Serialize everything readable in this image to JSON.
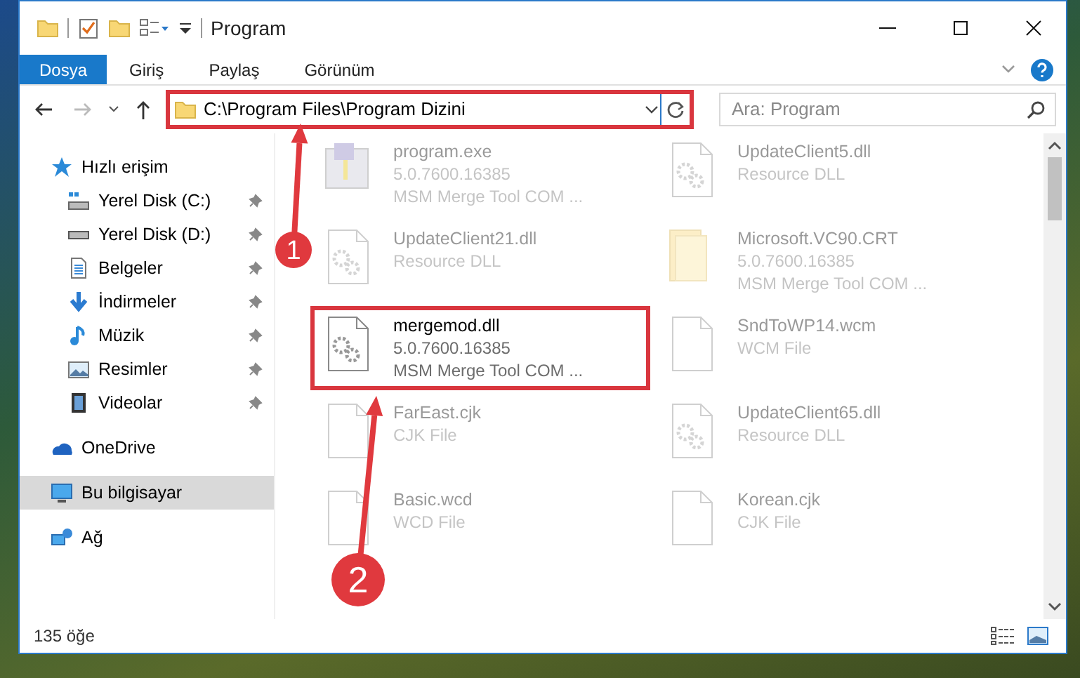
{
  "window": {
    "title": "Program"
  },
  "ribbon_tabs": [
    {
      "label": "Dosya",
      "kind": "file",
      "selected": false
    },
    {
      "label": "Giriş",
      "kind": "tab",
      "selected": false
    },
    {
      "label": "Paylaş",
      "kind": "tab",
      "selected": false
    },
    {
      "label": "Görünüm",
      "kind": "tab",
      "selected": false
    }
  ],
  "address_bar": {
    "path": "C:\\Program Files\\Program Dizini",
    "highlighted": true
  },
  "search": {
    "placeholder": "Ara: Program"
  },
  "sidebar": {
    "items": [
      {
        "label": "Hızlı erişim",
        "kind": "quick-access",
        "selected": false,
        "children": [
          {
            "label": "Yerel Disk (C:)",
            "kind": "system-drive",
            "pinned": true,
            "selected": false
          },
          {
            "label": "Yerel Disk (D:)",
            "kind": "drive",
            "pinned": true,
            "selected": false
          },
          {
            "label": "Belgeler",
            "kind": "documents",
            "pinned": true,
            "selected": false
          },
          {
            "label": "İndirmeler",
            "kind": "downloads",
            "pinned": true,
            "selected": false
          },
          {
            "label": "Müzik",
            "kind": "music",
            "pinned": true,
            "selected": false
          },
          {
            "label": "Resimler",
            "kind": "pictures",
            "pinned": true,
            "selected": false
          },
          {
            "label": "Videolar",
            "kind": "videos",
            "pinned": true,
            "selected": false
          }
        ]
      },
      {
        "label": "OneDrive",
        "kind": "cloud",
        "selected": false
      },
      {
        "label": "Bu bilgisayar",
        "kind": "computer",
        "selected": true
      },
      {
        "label": "Ağ",
        "kind": "network",
        "selected": false
      }
    ]
  },
  "files": [
    {
      "name": "program.exe",
      "details": [
        "5.0.7600.16385",
        "MSM Merge Tool COM ..."
      ],
      "kind": "exe",
      "blurred": true,
      "highlighted": false
    },
    {
      "name": "UpdateClient5.dll",
      "details": [
        "Resource DLL"
      ],
      "kind": "dll",
      "blurred": true,
      "highlighted": false
    },
    {
      "name": "UpdateClient21.dll",
      "details": [
        "Resource DLL"
      ],
      "kind": "dll",
      "blurred": true,
      "highlighted": false
    },
    {
      "name": "Microsoft.VC90.CRT",
      "details": [
        "5.0.7600.16385",
        "MSM Merge Tool COM ..."
      ],
      "kind": "folder",
      "blurred": true,
      "highlighted": false
    },
    {
      "name": "mergemod.dll",
      "details": [
        "5.0.7600.16385",
        "MSM Merge Tool COM ..."
      ],
      "kind": "dll",
      "blurred": false,
      "highlighted": true
    },
    {
      "name": "SndToWP14.wcm",
      "details": [
        "WCM File"
      ],
      "kind": "blank",
      "blurred": true,
      "highlighted": false
    },
    {
      "name": "FarEast.cjk",
      "details": [
        "CJK File"
      ],
      "kind": "blank",
      "blurred": true,
      "highlighted": false
    },
    {
      "name": "UpdateClient65.dll",
      "details": [
        "Resource DLL"
      ],
      "kind": "dll",
      "blurred": true,
      "highlighted": false
    },
    {
      "name": "Basic.wcd",
      "details": [
        "WCD File"
      ],
      "kind": "blank",
      "blurred": true,
      "highlighted": false
    },
    {
      "name": "Korean.cjk",
      "details": [
        "CJK File"
      ],
      "kind": "blank",
      "blurred": true,
      "highlighted": false
    }
  ],
  "status_bar": {
    "count": "135 öğe"
  },
  "annotations": [
    {
      "number": "1"
    },
    {
      "number": "2"
    }
  ]
}
